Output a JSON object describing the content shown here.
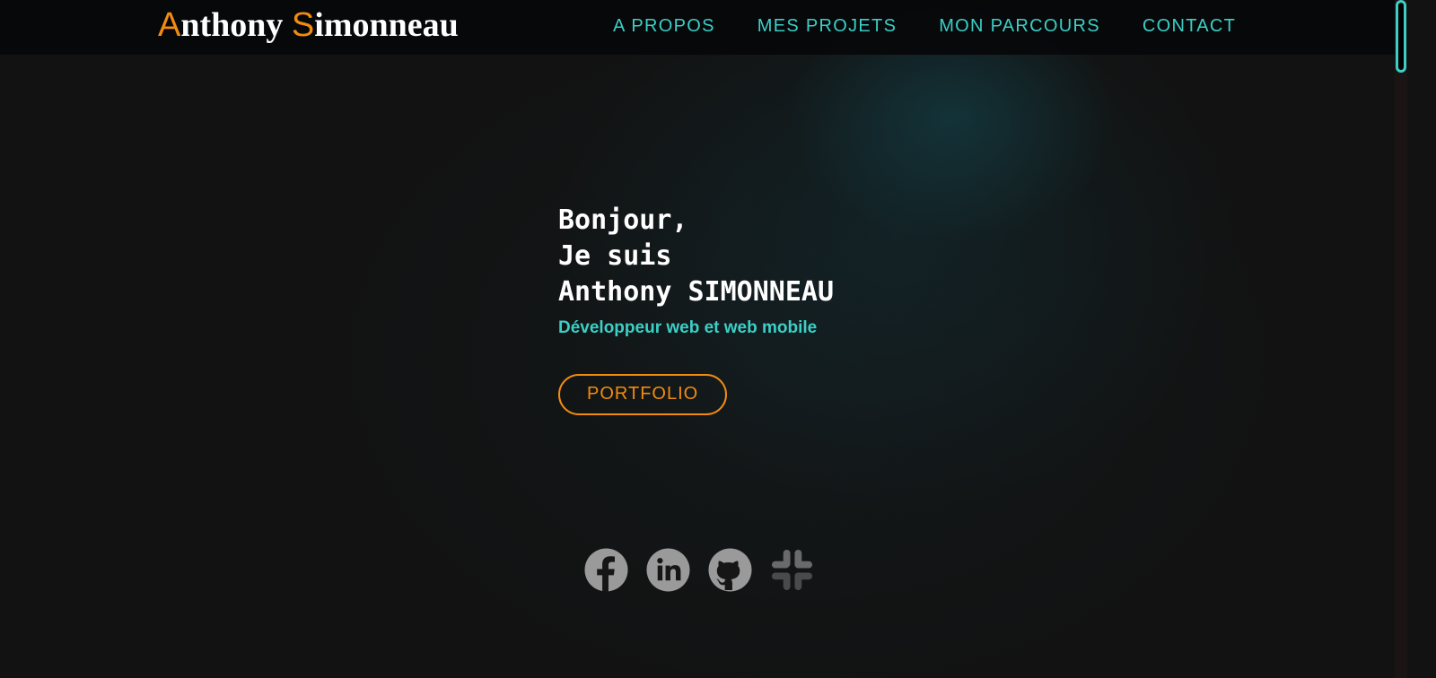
{
  "header": {
    "logo": {
      "first_initial": "A",
      "first_rest": "nthony",
      "last_initial": "S",
      "last_rest": "imonneau"
    },
    "nav": [
      "A PROPOS",
      "MES PROJETS",
      "MON PARCOURS",
      "CONTACT"
    ]
  },
  "hero": {
    "line1": "Bonjour,",
    "line2": "Je suis",
    "line3": "Anthony SIMONNEAU",
    "subtitle": "Développeur web et web mobile",
    "button": "PORTFOLIO"
  },
  "social": [
    "facebook-icon",
    "linkedin-icon",
    "github-icon",
    "slack-icon"
  ],
  "colors": {
    "accent_orange": "#f28c0f",
    "accent_teal": "#3ccfc6",
    "background": "#121212"
  }
}
